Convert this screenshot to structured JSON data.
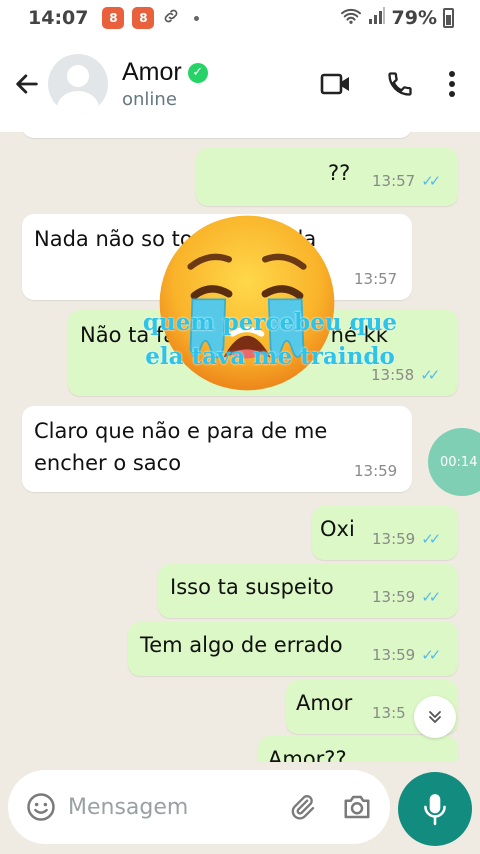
{
  "status_bar": {
    "time": "14:07",
    "battery": "79%",
    "notification_badges": [
      "8",
      "8"
    ]
  },
  "header": {
    "contact_name": "Amor",
    "contact_status": "online"
  },
  "messages": [
    {
      "text": "??",
      "time": "13:57"
    },
    {
      "text": "Nada não  so to",
      "text_tail": "da",
      "emoji": "😭",
      "time": "13:57"
    },
    {
      "text": "Não ta fazendo nada aí né kk",
      "time": "13:58"
    },
    {
      "line1": "Claro que não e para de me",
      "line2": "encher o saco",
      "time": "13:59"
    },
    {
      "text": "Oxi",
      "time": "13:59"
    },
    {
      "text": "Isso ta suspeito",
      "time": "13:59"
    },
    {
      "text": "Tem algo de errado",
      "time": "13:59"
    },
    {
      "text": "Amor",
      "time": "13:5"
    },
    {
      "text": "Amor??",
      "time": ""
    }
  ],
  "overlay": {
    "line1": "quem percebeu que",
    "line2": "ela tava me traindo"
  },
  "timer_badge": "00:14",
  "composer": {
    "placeholder": "Mensagem"
  },
  "colors": {
    "outgoing_bubble": "#dcf8c6",
    "incoming_bubble": "#ffffff",
    "chat_background": "#efeae2",
    "read_tick": "#53bdeb",
    "mic_button": "#128c7e",
    "verified": "#25d366"
  },
  "icons": [
    "back-arrow",
    "video-call",
    "phone-call",
    "more-vertical",
    "emoji",
    "attach",
    "camera",
    "microphone",
    "chevron-down"
  ]
}
